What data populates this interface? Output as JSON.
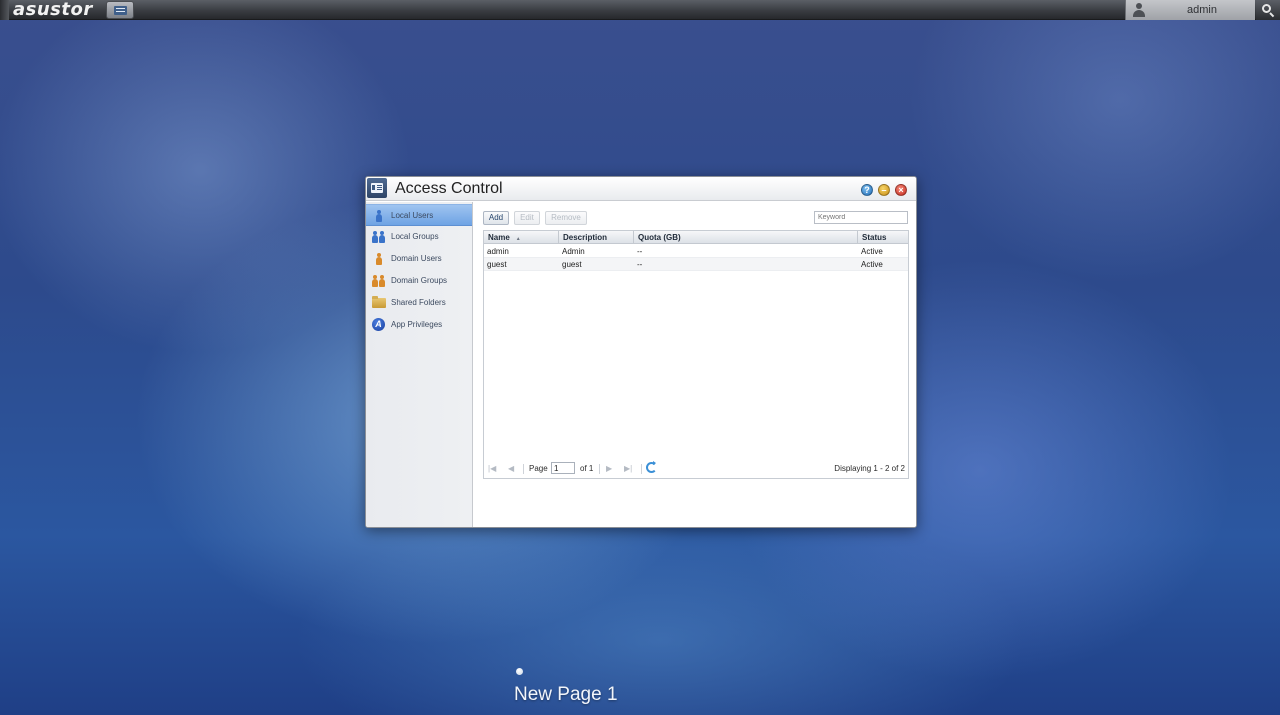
{
  "topbar": {
    "logo_text": "asustor",
    "username": "admin"
  },
  "window": {
    "title": "Access Control",
    "controls": {
      "help": "?",
      "minimize": "–",
      "close": "×"
    }
  },
  "sidebar": {
    "items": [
      {
        "label": "Local Users",
        "icon": "user-icon",
        "active": true
      },
      {
        "label": "Local Groups",
        "icon": "users-group-icon",
        "active": false
      },
      {
        "label": "Domain Users",
        "icon": "domain-user-icon",
        "active": false
      },
      {
        "label": "Domain Groups",
        "icon": "domain-group-icon",
        "active": false
      },
      {
        "label": "Shared Folders",
        "icon": "folder-icon",
        "active": false
      },
      {
        "label": "App Privileges",
        "icon": "app-privileges-icon",
        "active": false
      }
    ]
  },
  "toolbar": {
    "add_label": "Add",
    "edit_label": "Edit",
    "remove_label": "Remove",
    "search_placeholder": "Keyword"
  },
  "table": {
    "columns": [
      "Name",
      "Description",
      "Quota (GB)",
      "Status"
    ],
    "rows": [
      {
        "name": "admin",
        "description": "Admin",
        "quota": "--",
        "status": "Active"
      },
      {
        "name": "guest",
        "description": "guest",
        "quota": "--",
        "status": "Active"
      }
    ]
  },
  "pager": {
    "page_label": "Page",
    "page_value": "1",
    "of_label": "of 1",
    "displaying": "Displaying 1 - 2 of 2"
  },
  "desktop": {
    "page_name": "New Page 1"
  }
}
